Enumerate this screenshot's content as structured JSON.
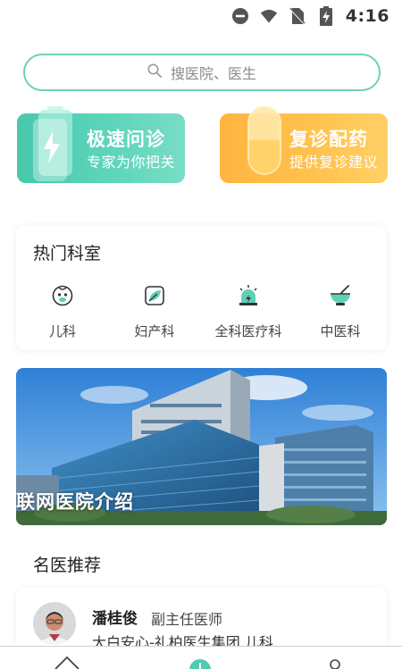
{
  "status_bar": {
    "time": "4:16",
    "icons": [
      "do-not-disturb-icon",
      "wifi-icon",
      "no-sim-icon",
      "battery-charging-icon"
    ]
  },
  "search": {
    "placeholder": "搜医院、医生",
    "icon": "search-icon"
  },
  "promos": [
    {
      "title": "极速问诊",
      "subtitle": "专家为你把关",
      "icon": "battery-bolt-icon",
      "color": "#49c8ad"
    },
    {
      "title": "复诊配药",
      "subtitle": "提供复诊建议",
      "icon": "capsule-icon",
      "color": "#ffb540"
    }
  ],
  "departments": {
    "title": "热门科室",
    "items": [
      {
        "label": "儿科",
        "icon": "baby-face-icon"
      },
      {
        "label": "妇产科",
        "icon": "leaf-box-icon"
      },
      {
        "label": "全科医疗科",
        "icon": "alarm-light-icon"
      },
      {
        "label": "中医科",
        "icon": "mortar-icon"
      }
    ]
  },
  "banner": {
    "text": "联网医院介绍"
  },
  "recommend": {
    "title": "名医推荐",
    "doctors": [
      {
        "name": "潘桂俊",
        "rank": "副主任医师",
        "org": "大白安心-礼柏医生集团 儿科"
      }
    ]
  },
  "bottom_nav": {
    "icons": [
      "home-icon",
      "add-icon",
      "profile-icon"
    ]
  },
  "colors": {
    "accent": "#4fcbb0",
    "orange": "#ffb540"
  }
}
